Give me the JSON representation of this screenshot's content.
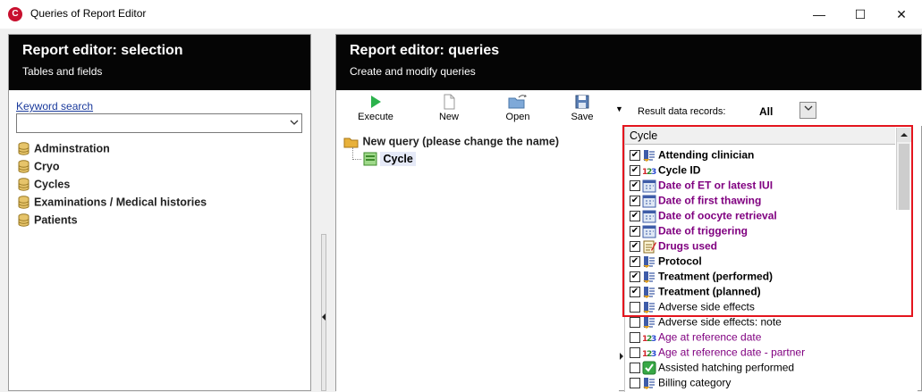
{
  "window": {
    "title": "Queries of Report Editor",
    "app_icon_glyph": "C",
    "controls": {
      "minimize": "—",
      "maximize": "☐",
      "close": "✕"
    }
  },
  "left_panel": {
    "title": "Report editor: selection",
    "subtitle": "Tables and fields",
    "keyword_label": "Keyword search",
    "keyword_value": "",
    "tree": [
      {
        "label": "Adminstration",
        "icon": "database-icon"
      },
      {
        "label": "Cryo",
        "icon": "database-icon"
      },
      {
        "label": "Cycles",
        "icon": "database-icon"
      },
      {
        "label": "Examinations / Medical histories",
        "icon": "database-icon"
      },
      {
        "label": "Patients",
        "icon": "database-icon"
      }
    ]
  },
  "right_panel": {
    "title": "Report editor: queries",
    "subtitle": "Create and modify queries",
    "toolbar": [
      {
        "label": "Execute",
        "icon": "play-icon"
      },
      {
        "label": "New",
        "icon": "new-document-icon"
      },
      {
        "label": "Open",
        "icon": "open-folder-icon"
      },
      {
        "label": "Save",
        "icon": "floppy-disk-icon"
      }
    ],
    "toolbar_more": "▼",
    "result_label": "Result data records:",
    "result_value": "All",
    "query_tree": {
      "root": "New query (please change the name)",
      "child": "Cycle"
    },
    "fields_header": "Cycle",
    "fields": [
      {
        "label": "Attending clinician",
        "checked": true,
        "style": "bold",
        "icon": "text-field-icon"
      },
      {
        "label": "Cycle ID",
        "checked": true,
        "style": "bold",
        "icon": "number-field-icon"
      },
      {
        "label": "Date of ET or latest IUI",
        "checked": true,
        "style": "bold-purple",
        "icon": "date-field-icon"
      },
      {
        "label": "Date of first thawing",
        "checked": true,
        "style": "bold-purple",
        "icon": "date-field-icon"
      },
      {
        "label": "Date of oocyte retrieval",
        "checked": true,
        "style": "bold-purple",
        "icon": "date-field-icon"
      },
      {
        "label": "Date of triggering",
        "checked": true,
        "style": "bold-purple",
        "icon": "date-field-icon"
      },
      {
        "label": "Drugs used",
        "checked": true,
        "style": "bold-purple",
        "icon": "memo-field-icon"
      },
      {
        "label": "Protocol",
        "checked": true,
        "style": "bold",
        "icon": "text-field-icon"
      },
      {
        "label": "Treatment (performed)",
        "checked": true,
        "style": "bold",
        "icon": "text-field-icon"
      },
      {
        "label": "Treatment (planned)",
        "checked": true,
        "style": "bold",
        "icon": "text-field-icon"
      },
      {
        "label": "Adverse side effects",
        "checked": false,
        "style": "normal",
        "icon": "text-field-icon"
      },
      {
        "label": "Adverse side effects: note",
        "checked": false,
        "style": "normal",
        "icon": "text-field-icon"
      },
      {
        "label": "Age at reference date",
        "checked": false,
        "style": "purple",
        "icon": "number-field-icon"
      },
      {
        "label": "Age at reference date - partner",
        "checked": false,
        "style": "purple",
        "icon": "number-field-icon"
      },
      {
        "label": "Assisted hatching performed",
        "checked": false,
        "style": "normal",
        "icon": "boolean-field-icon"
      },
      {
        "label": "Billing category",
        "checked": false,
        "style": "normal",
        "icon": "text-field-icon"
      }
    ]
  }
}
